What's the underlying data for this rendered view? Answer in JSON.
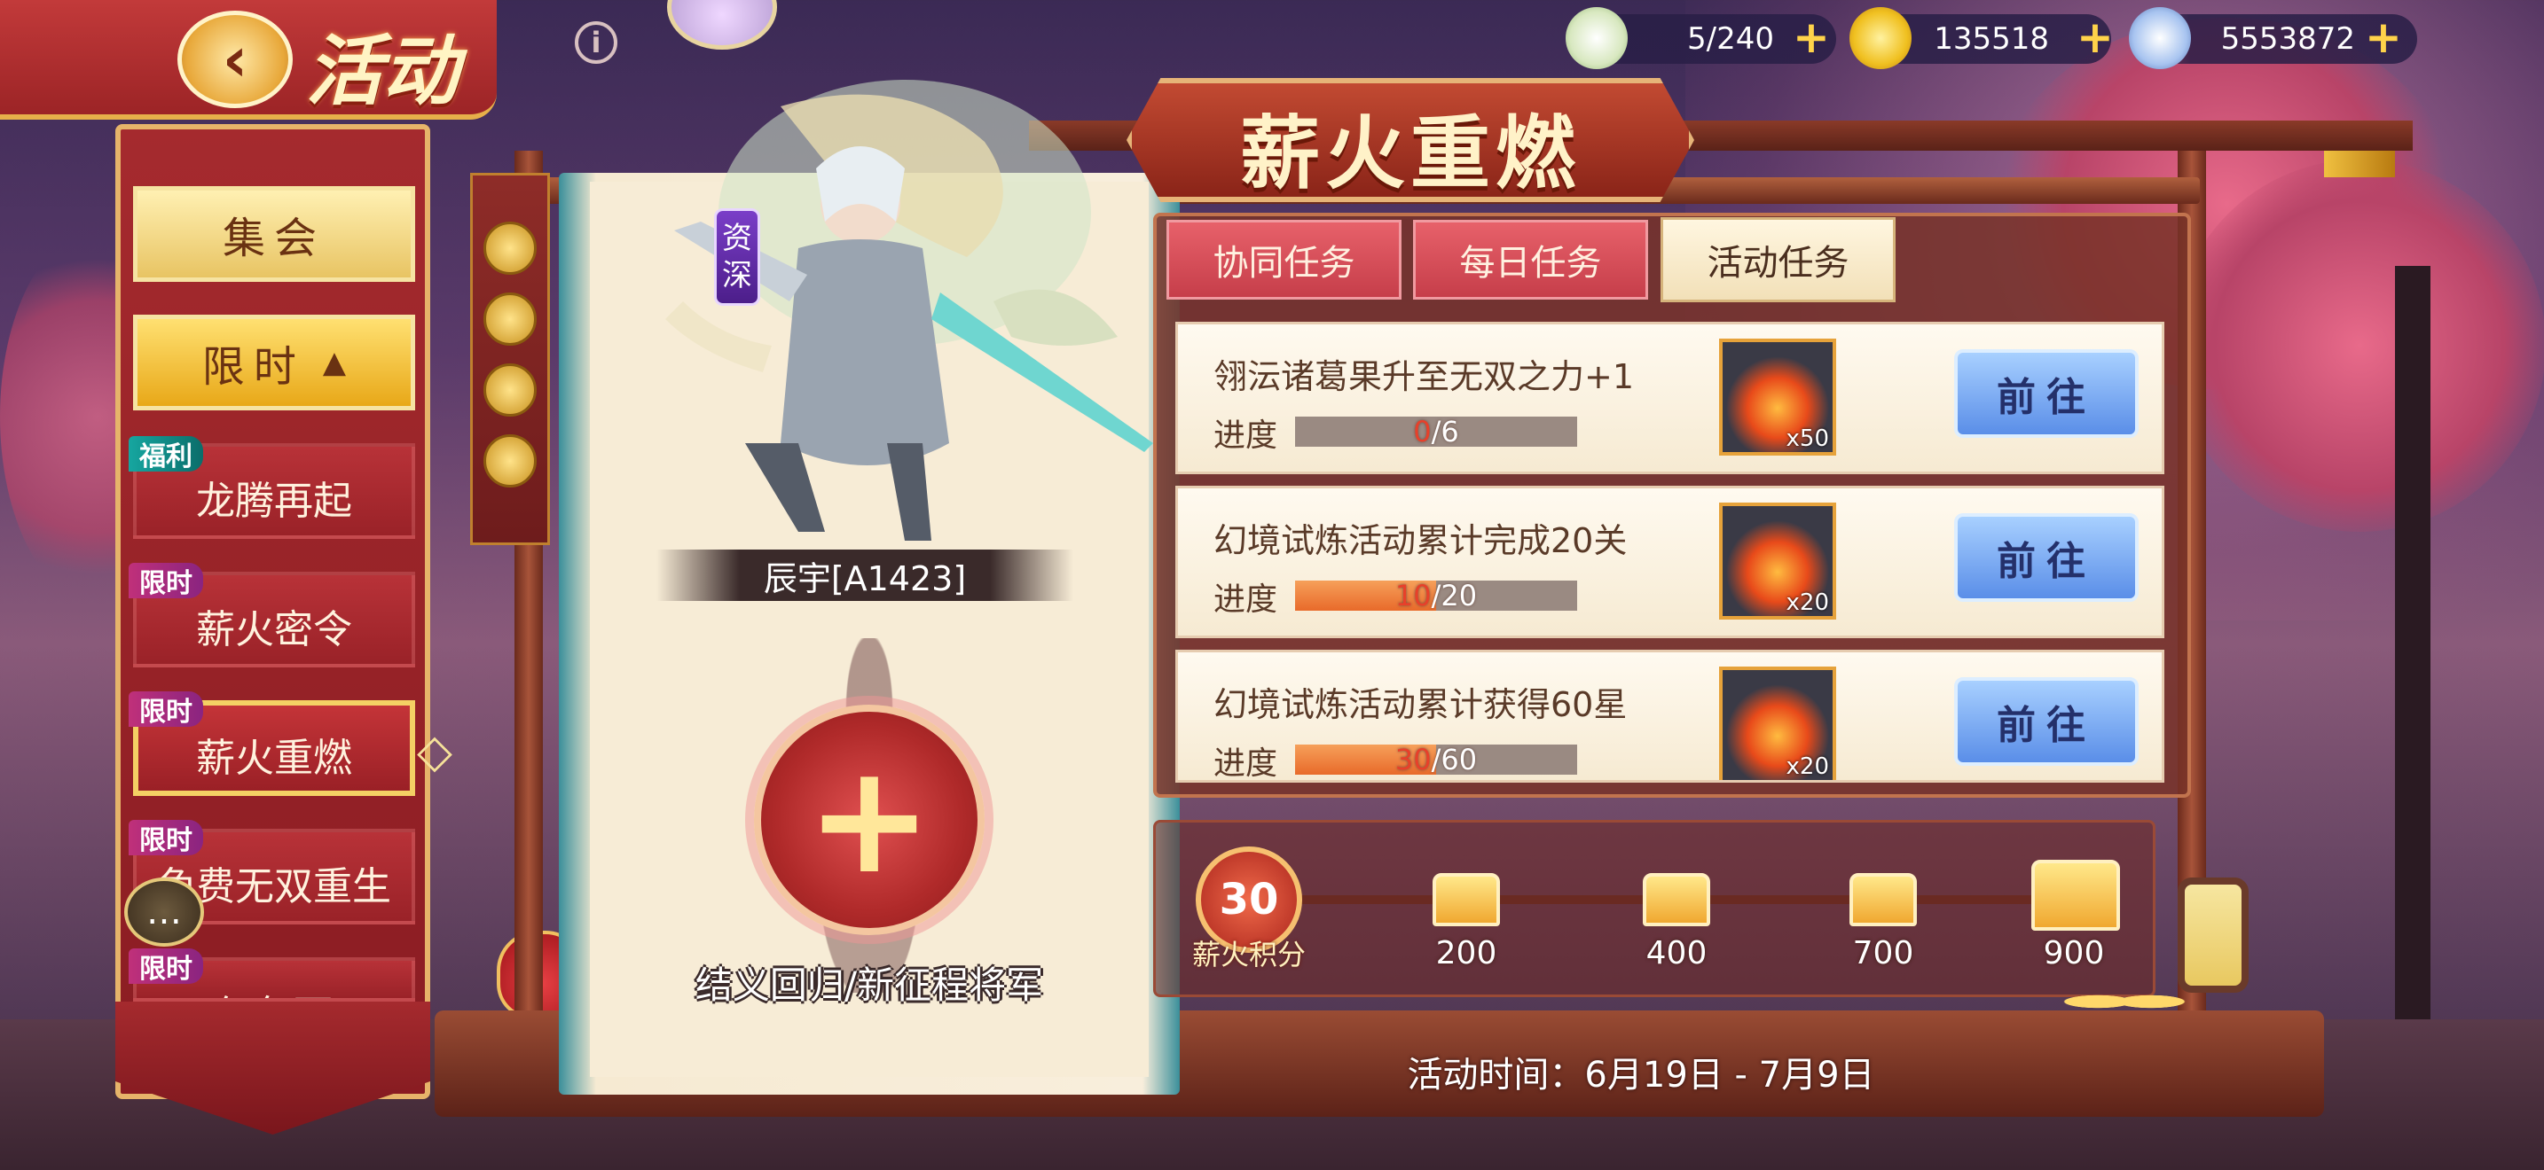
{
  "header": {
    "title": "活动",
    "back_icon": "back-arrow-icon",
    "info_label": "i"
  },
  "resources": [
    {
      "icon": "peach-bun-icon",
      "value": "5/240"
    },
    {
      "icon": "gold-ingot-icon",
      "value": "135518"
    },
    {
      "icon": "silver-coin-icon",
      "value": "5553872"
    }
  ],
  "plus_label": "+",
  "nav": {
    "group1": "集会",
    "group2": "限时",
    "group2_arrow": "▲",
    "items": [
      {
        "tag": "福利",
        "label": "龙腾再起"
      },
      {
        "tag": "限时",
        "label": "薪火密令"
      },
      {
        "tag": "限时",
        "label": "薪火重燃"
      },
      {
        "tag": "限时",
        "label": "免费无双重生"
      },
      {
        "tag": "限时",
        "label": "红包雨"
      }
    ],
    "selected_arrow": "◇"
  },
  "panel_title": "薪火重燃",
  "hero": {
    "badge": [
      "资",
      "深"
    ],
    "name": "辰宇[A1423]",
    "recruit_text": "结义回归/新征程将军",
    "add_symbol": "+"
  },
  "tabs": [
    {
      "label": "协同任务",
      "active": false
    },
    {
      "label": "每日任务",
      "active": false
    },
    {
      "label": "活动任务",
      "active": true
    }
  ],
  "tasks": [
    {
      "name": "翎沄诸葛果升至无双之力+1",
      "progress_label": "进度",
      "current": "0",
      "total": "/6",
      "fraction": 0,
      "reward_count": "x50",
      "button": "前往"
    },
    {
      "name": "幻境试炼活动累计完成20关",
      "progress_label": "进度",
      "current": "10",
      "total": "/20",
      "fraction": 0.5,
      "reward_count": "x20",
      "button": "前往"
    },
    {
      "name": "幻境试炼活动累计获得60星",
      "progress_label": "进度",
      "current": "30",
      "total": "/60",
      "fraction": 0.5,
      "reward_count": "x20",
      "button": "前往"
    }
  ],
  "points": {
    "value": "30",
    "label": "薪火积分",
    "milestones": [
      "200",
      "400",
      "700",
      "900"
    ]
  },
  "event_time": "活动时间：6月19日 - 7月9日",
  "chat_icon_glyph": "…"
}
